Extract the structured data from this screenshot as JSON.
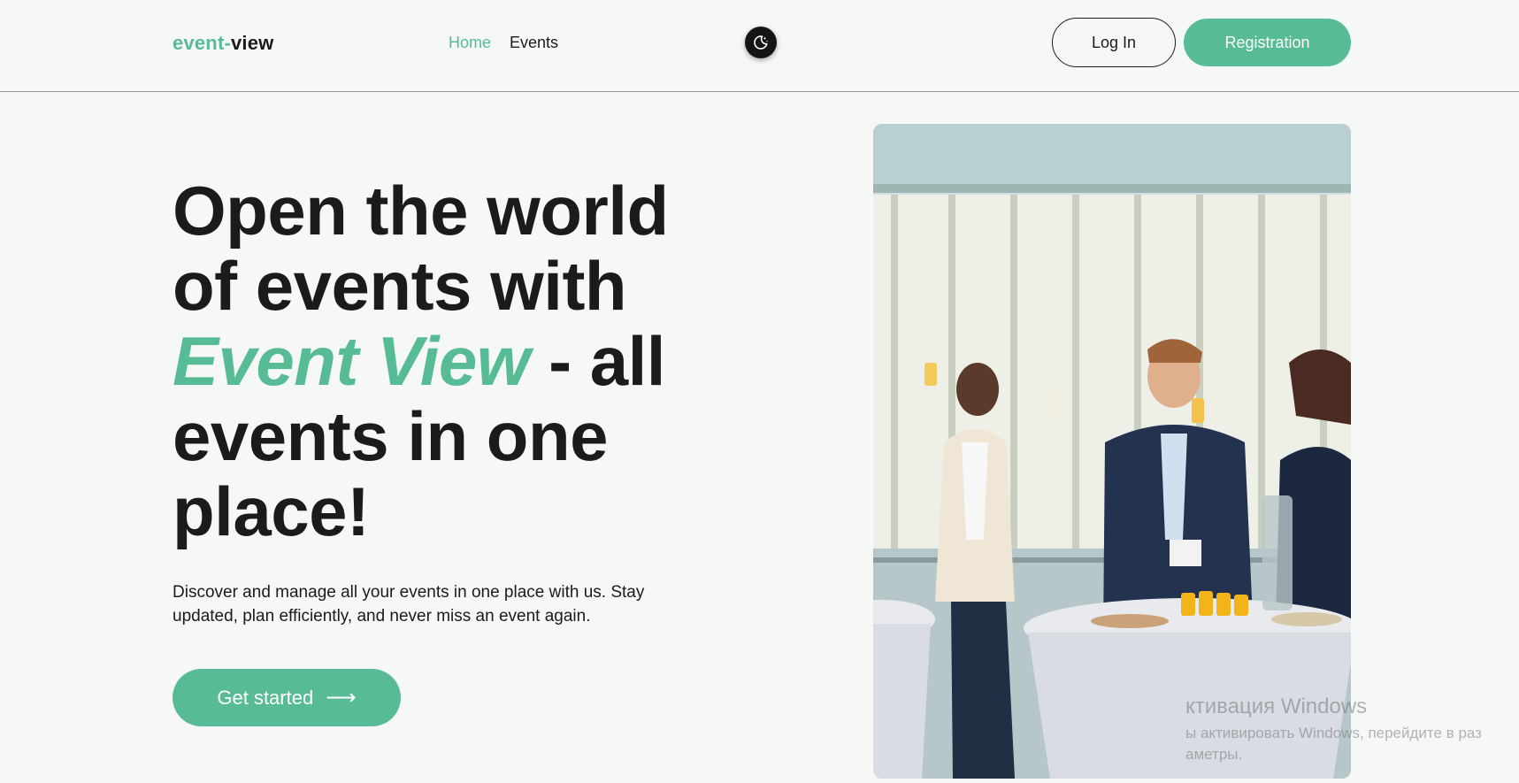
{
  "header": {
    "logo": {
      "part1": "event-",
      "part2": "view"
    },
    "nav": [
      {
        "label": "Home",
        "active": true
      },
      {
        "label": "Events",
        "active": false
      }
    ],
    "theme_toggle_icon": "moon-stars-icon",
    "login_label": "Log In",
    "register_label": "Registration"
  },
  "hero": {
    "title_line1": "Open the world",
    "title_line2": "of events with",
    "title_brand": "Event View",
    "title_after_brand": " - all",
    "title_line4": "events in one",
    "title_line5": "place!",
    "description_line1": "Discover and manage all your events in one place with us. Stay",
    "description_line2": "updated, plan efficiently, and never miss an event again.",
    "cta_label": "Get started",
    "cta_icon": "arrow-right-icon"
  },
  "watermark": {
    "title": "ктивация Windows",
    "line1": "ы активировать Windows, перейдите в раз",
    "line2": "аметры."
  },
  "colors": {
    "accent": "#57bc95",
    "text": "#1b1b1b",
    "background": "#f5f8f7"
  }
}
